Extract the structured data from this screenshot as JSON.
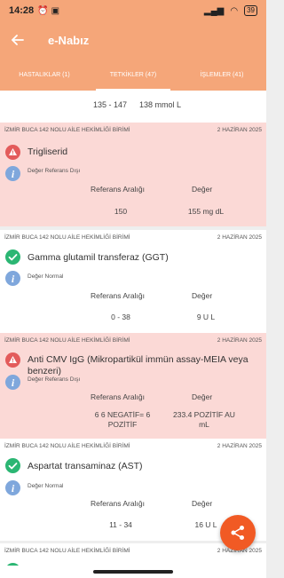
{
  "status_bar": {
    "time": "14:28",
    "battery": "39"
  },
  "app": {
    "title": "e-Nabız"
  },
  "tabs": [
    {
      "label": "HASTALIKLAR (1)"
    },
    {
      "label": "TETKİKLER (47)"
    },
    {
      "label": "İŞLEMLER (41)"
    }
  ],
  "partial_row": {
    "ref": "135 - 147",
    "value": "138  mmol L"
  },
  "cards": [
    {
      "institution": "İZMİR BUCA 142 NOLU AİLE HEKİMLİĞİ BİRİMİ",
      "date": "2 HAZİRAN 2025",
      "test": "Trigliserid",
      "status_label": "Değer Referans Dışı",
      "ref_header": "Referans Aralığı",
      "val_header": "Değer",
      "ref": "150",
      "value": "155  mg dL"
    },
    {
      "institution": "İZMİR BUCA 142 NOLU AİLE HEKİMLİĞİ BİRİMİ",
      "date": "2 HAZİRAN 2025",
      "test": "Gamma glutamil transferaz (GGT)",
      "status_label": "Değer Normal",
      "ref_header": "Referans Aralığı",
      "val_header": "Değer",
      "ref": "0 - 38",
      "value": "9  U L"
    },
    {
      "institution": "İZMİR BUCA 142 NOLU AİLE HEKİMLİĞİ BİRİMİ",
      "date": "2 HAZİRAN 2025",
      "test": "Anti CMV IgG (Mikropartikül immün assay-MEIA veya benzeri)",
      "status_label": "Değer Referans Dışı",
      "ref_header": "Referans Aralığı",
      "val_header": "Değer",
      "ref": "6  6 NEGATİF= 6 POZİTİF",
      "value": "233.4 POZİTİF AU mL"
    },
    {
      "institution": "İZMİR BUCA 142 NOLU AİLE HEKİMLİĞİ BİRİMİ",
      "date": "2 HAZİRAN 2025",
      "test": "Aspartat transaminaz (AST)",
      "status_label": "Değer Normal",
      "ref_header": "Referans Aralığı",
      "val_header": "Değer",
      "ref": "11 - 34",
      "value": "16  U L"
    },
    {
      "institution": "İZMİR BUCA 142 NOLU AİLE HEKİMLİĞİ BİRİMİ",
      "date": "2 HAZİRAN 2025"
    }
  ],
  "colors": {
    "accent": "#f5a679",
    "out_of_range": "#fbd9d6",
    "alert_red": "#e35b5b",
    "ok_green": "#2bb673",
    "info_blue": "#7fa7dc",
    "fab": "#f15a24"
  },
  "icons": {
    "back": "arrow-left-icon",
    "warning": "warning-triangle-icon",
    "ok": "check-circle-icon",
    "info": "info-icon",
    "share": "share-icon"
  }
}
